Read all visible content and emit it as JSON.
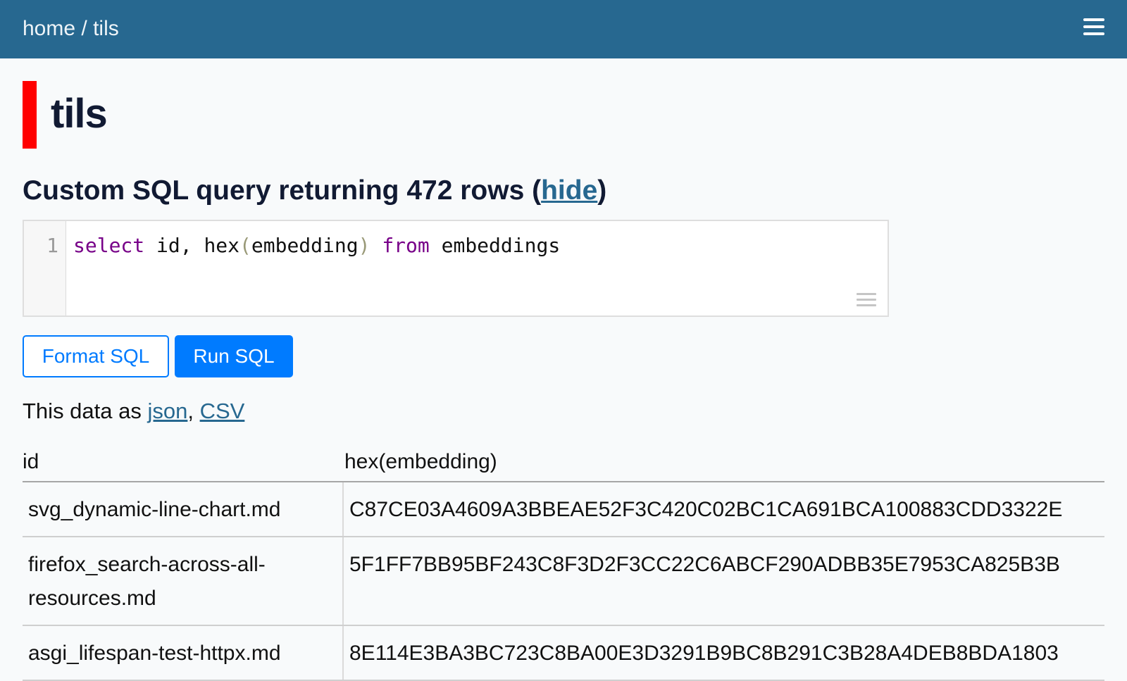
{
  "nav": {
    "home": "home",
    "separator": " / ",
    "current": "tils"
  },
  "database": {
    "title": "tils"
  },
  "query": {
    "title_prefix": "Custom SQL query returning 472 rows (",
    "hide_link": "hide",
    "title_suffix": ")",
    "line_number": "1",
    "code_tokens": {
      "select": "select",
      "cols": " id, hex",
      "lparen": "(",
      "arg": "embedding",
      "rparen": ")",
      "space": " ",
      "from": "from",
      "table": " embeddings"
    }
  },
  "buttons": {
    "format": "Format SQL",
    "run": "Run SQL"
  },
  "export": {
    "prefix": "This data as ",
    "json": "json",
    "comma": ", ",
    "csv": "CSV"
  },
  "table": {
    "columns": [
      "id",
      "hex(embedding)"
    ],
    "rows": [
      {
        "id": "svg_dynamic-line-chart.md",
        "hex": "C87CE03A4609A3BBEAE52F3C420C02BC1CA691BCA100883CDD3322E"
      },
      {
        "id": "firefox_search-across-all-resources.md",
        "hex": "5F1FF7BB95BF243C8F3D2F3CC22C6ABCF290ADBB35E7953CA825B3B"
      },
      {
        "id": "asgi_lifespan-test-httpx.md",
        "hex": "8E114E3BA3BC723C8BA00E3D3291B9BC8B291C3B28A4DEB8BDA1803"
      }
    ]
  }
}
